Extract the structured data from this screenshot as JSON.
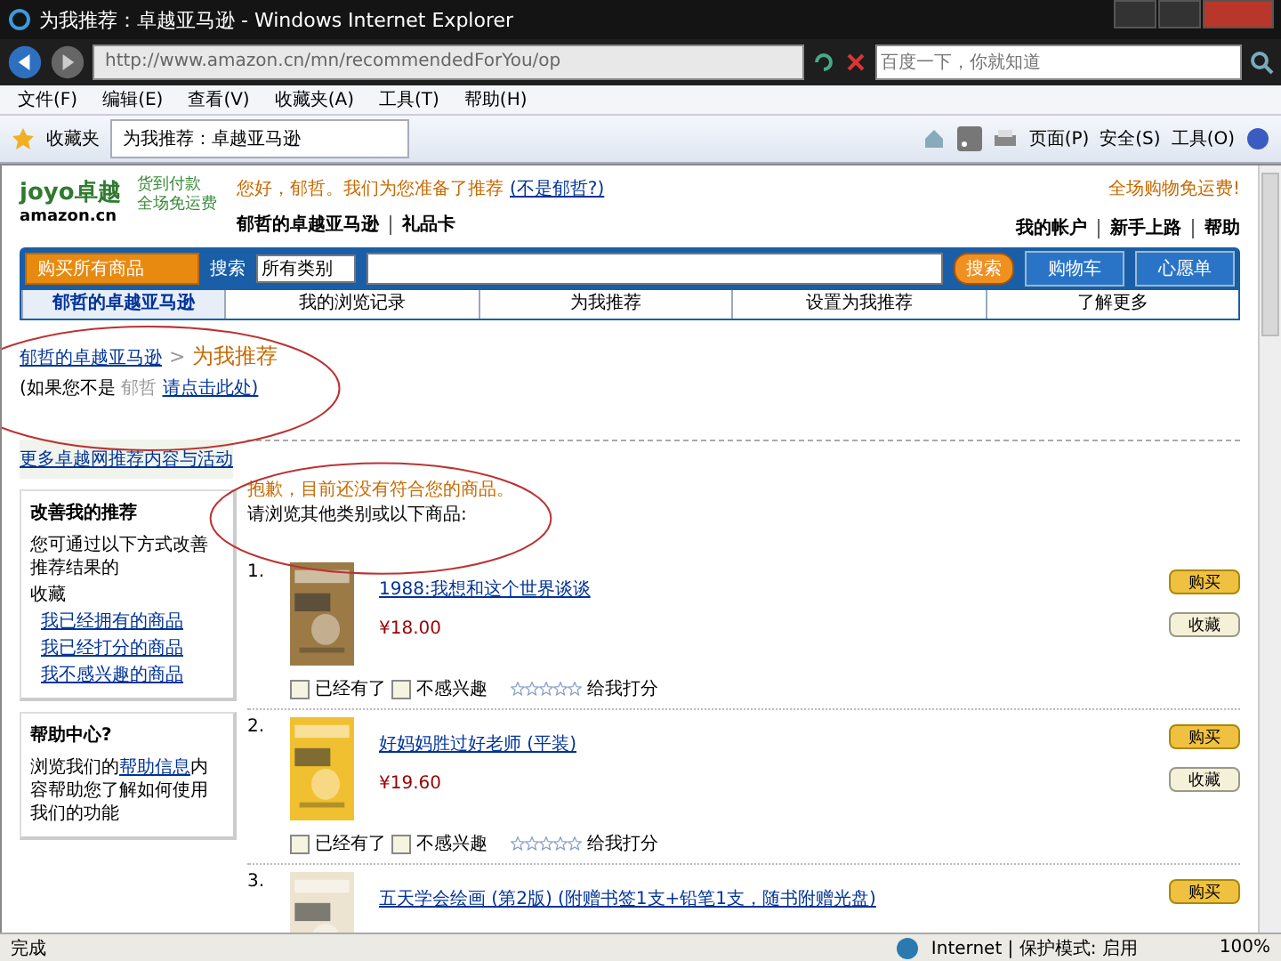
{
  "window": {
    "title": "为我推荐：卓越亚马逊 - Windows Internet Explorer"
  },
  "address_bar": {
    "url": "http://www.amazon.cn/mn/recommendedForYou/op",
    "search_placeholder": "百度一下，你就知道"
  },
  "menu": [
    "文件(F)",
    "编辑(E)",
    "查看(V)",
    "收藏夹(A)",
    "工具(T)",
    "帮助(H)"
  ],
  "favorites_bar": {
    "label": "收藏夹",
    "tab": "为我推荐：卓越亚马逊",
    "commands": [
      "页面(P)",
      "安全(S)",
      "工具(O)"
    ]
  },
  "header": {
    "logo_main": "joyo卓越",
    "logo_sub": "amazon.cn",
    "slogan": [
      "货到付款",
      "全场免运费"
    ],
    "greeting": "您好，郁哲。我们为您准备了推荐",
    "greeting_link": "(不是郁哲?)",
    "promo": "全场购物免运费!",
    "store_link": "郁哲的卓越亚马逊",
    "gift_link": "礼品卡",
    "account_links": [
      "我的帐户",
      "新手上路",
      "帮助"
    ]
  },
  "search_bar": {
    "department": "购买所有商品",
    "label": "搜索",
    "category": "所有类别",
    "search_button": "搜索",
    "cart_button": "购物车",
    "wishlist_button": "心愿单"
  },
  "nav_tabs": [
    {
      "label": "郁哲的卓越亚马逊",
      "selected": true
    },
    {
      "label": "我的浏览记录",
      "selected": false
    },
    {
      "label": "为我推荐",
      "selected": false
    },
    {
      "label": "设置为我推荐",
      "selected": false
    },
    {
      "label": "了解更多",
      "selected": false
    }
  ],
  "breadcrumb": {
    "parent": "郁哲的卓越亚马逊",
    "separator": ">",
    "current": "为我推荐"
  },
  "not_you": {
    "text": "(如果您不是",
    "name": "郁哲",
    "link": "请点击此处)"
  },
  "sidebar": {
    "more_link": "更多卓越网推荐内容与活动",
    "improve": {
      "title": "改善我的推荐",
      "text": "您可通过以下方式改善推荐结果的",
      "text2": "收藏",
      "links": [
        "我已经拥有的商品",
        "我已经打分的商品",
        "我不感兴趣的商品"
      ]
    },
    "help": {
      "title": "帮助中心?",
      "before": "浏览我们的",
      "link": "帮助信息",
      "after": "内容帮助您了解如何使用我们的功能"
    }
  },
  "notice": {
    "warning": "抱歉，目前还没有符合您的商品。",
    "hint": "请浏览其他类别或以下商品:"
  },
  "products": [
    {
      "index": "1.",
      "title": "1988:我想和这个世界谈谈",
      "price": "¥18.00",
      "owned_label": "已经有了",
      "owned_checked": false,
      "not_interested_label": "不感兴趣",
      "not_interested_checked": false,
      "stars": 0,
      "rate_label": "给我打分",
      "buy": "购买",
      "save": "收藏"
    },
    {
      "index": "2.",
      "title": "好妈妈胜过好老师 (平装)",
      "price": "¥19.60",
      "owned_label": "已经有了",
      "owned_checked": false,
      "not_interested_label": "不感兴趣",
      "not_interested_checked": false,
      "stars": 0,
      "rate_label": "给我打分",
      "buy": "购买",
      "save": "收藏"
    },
    {
      "index": "3.",
      "title": "五天学会绘画 (第2版) (附赠书签1支+铅笔1支，随书附赠光盘)",
      "buy": "购买"
    }
  ],
  "status_bar": {
    "text": "完成",
    "zone": "Internet | 保护模式: 启用",
    "zoom": "100%"
  }
}
